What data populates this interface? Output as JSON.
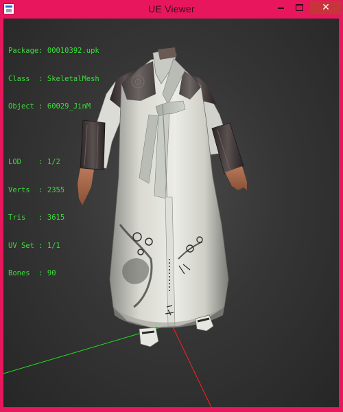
{
  "window": {
    "title": "UE Viewer",
    "accent_color": "#e8175d",
    "icon": "ue-viewer-app-icon"
  },
  "controls": {
    "minimize_icon": "minimize-icon",
    "maximize_icon": "maximize-icon",
    "close_icon": "close-icon",
    "close_glyph": "✕"
  },
  "info": {
    "package": "Package: 00010392.upk",
    "class": "Class  : SkeletalMesh",
    "object": "Object : 60029_JinM",
    "lod": "LOD    : 1/2",
    "verts": "Verts  : 2355",
    "tris": "Tris   : 3615",
    "uvset": "UV Set : 1/1",
    "bones": "Bones  : 90",
    "text_color": "#3bdc3b"
  },
  "viewport": {
    "background": "#333333",
    "axis_x_color": "#ff2020",
    "axis_z_color": "#20e020"
  }
}
